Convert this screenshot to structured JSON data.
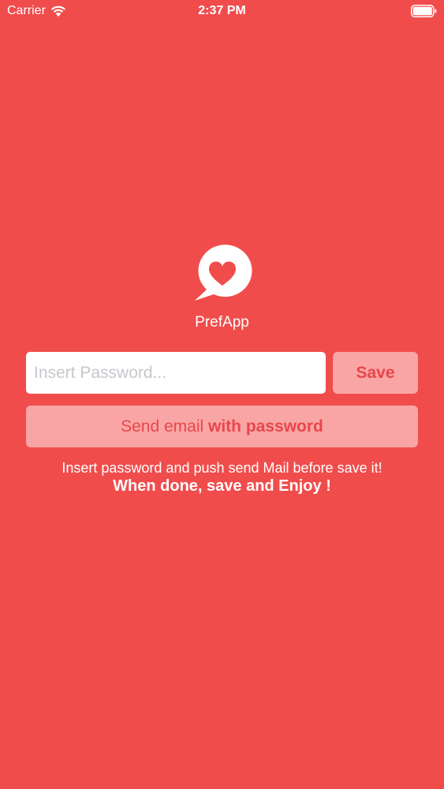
{
  "status_bar": {
    "carrier": "Carrier",
    "time": "2:37 PM",
    "wifi_icon": "wifi-icon",
    "battery_icon": "battery-icon"
  },
  "app": {
    "logo_icon": "heart-chat-bubble-icon",
    "name": "PrefApp"
  },
  "form": {
    "password_value": "",
    "password_placeholder": "Insert Password...",
    "save_label": "Save",
    "send_label_regular": "Send email ",
    "send_label_bold": "with password"
  },
  "messages": {
    "instruction": "Insert password and push send Mail before save it!",
    "enjoy": "When done, save and Enjoy !"
  },
  "colors": {
    "background": "#f14c4c",
    "button_background": "#f9a5a5",
    "button_text": "#e8474a",
    "text": "#ffffff"
  }
}
